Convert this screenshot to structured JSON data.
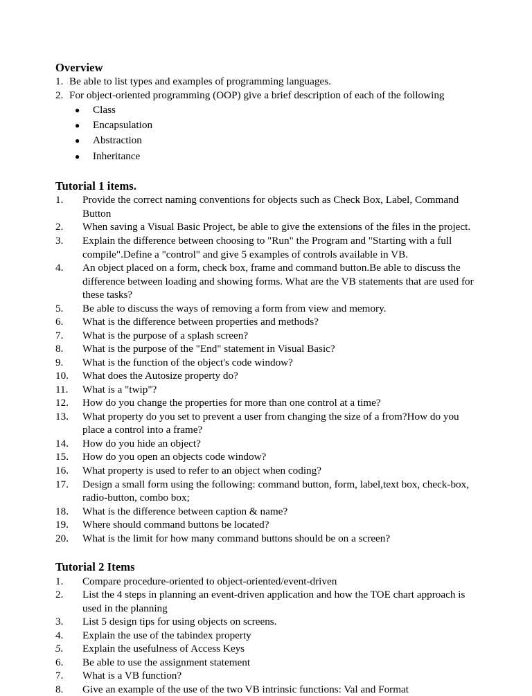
{
  "document": {
    "sections": [
      {
        "heading": "Overview",
        "list_style": "overview",
        "items": [
          {
            "number": "1.",
            "text": "Be able to list types and examples of programming languages."
          },
          {
            "number": "2.",
            "text": "For object-oriented programming (OOP) give a brief description of each of the following",
            "bullets": [
              "Class",
              "Encapsulation",
              "Abstraction",
              "Inheritance"
            ]
          }
        ]
      },
      {
        "heading": "Tutorial 1 items.",
        "list_style": "tutorial",
        "items": [
          {
            "number": "1.",
            "text": "Provide the correct naming conventions for objects such as Check Box, Label, Command Button"
          },
          {
            "number": "2.",
            "text": "When saving a Visual Basic Project, be able to give the extensions of the files in the project."
          },
          {
            "number": "3.",
            "text": "Explain the difference between choosing to \"Run\" the Program and \"Starting with a full compile\".Define a \"control\" and give 5 examples of controls available in VB."
          },
          {
            "number": "4.",
            "text": "An object placed on a form, check box, frame and command button.Be able to discuss the difference between loading and showing forms.  What are the VB statements that are used for these tasks?"
          },
          {
            "number": "5.",
            "text": "Be able to discuss the ways of removing a form from view and memory."
          },
          {
            "number": "6.",
            "text": "What is the difference between properties and methods?"
          },
          {
            "number": "7.",
            "text": "What is the purpose of a splash screen?"
          },
          {
            "number": "8.",
            "text": "What is the purpose of the \"End\" statement in Visual Basic?"
          },
          {
            "number": "9.",
            "text": "What is the function of the object's code window?"
          },
          {
            "number": "10.",
            "text": "What does the Autosize property do?"
          },
          {
            "number": "11.",
            "text": "What is a \"twip\"?"
          },
          {
            "number": "12.",
            "text": "How do you change the properties for more than one control at a time?"
          },
          {
            "number": "13.",
            "text": "What property do you set to prevent a user from changing the size of a from?How do you place a control into a frame?"
          },
          {
            "number": "14.",
            "text": "How do you hide an object?"
          },
          {
            "number": "15.",
            "text": "How do you open an objects code window?"
          },
          {
            "number": "16.",
            "text": "What property is used to refer to an object when coding?"
          },
          {
            "number": "17.",
            "text": "Design a small form using the following: command button, form, label,text box, check-box, radio-button, combo box;"
          },
          {
            "number": "18.",
            "text": "What is the difference between caption & name?"
          },
          {
            "number": "19.",
            "text": "Where should command buttons be located?"
          },
          {
            "number": "20.",
            "text": "What is the limit for how many command buttons should be on a screen?"
          }
        ]
      },
      {
        "heading": "Tutorial 2 Items",
        "list_style": "tutorial",
        "items": [
          {
            "number": "1.",
            "text": "Compare procedure-oriented to object-oriented/event-driven"
          },
          {
            "number": "2.",
            "text": "List the 4 steps in planning an event-driven application and how the TOE chart approach is used in the planning"
          },
          {
            "number": "3.",
            "text": "List 5 design tips for using objects on screens."
          },
          {
            "number": "4.",
            "text": "Explain the use of the tabindex property"
          },
          {
            "number": "5.",
            "text": "Explain the usefulness of Access Keys",
            "number_italic": true
          },
          {
            "number": "6.",
            "text": "Be able to use the assignment statement"
          },
          {
            "number": "7.",
            "text": "What is a VB function?"
          },
          {
            "number": "8.",
            "text": "Give an example of the use of the two VB intrinsic functions: Val and Format"
          }
        ]
      }
    ],
    "bullet_glyph": "●"
  }
}
